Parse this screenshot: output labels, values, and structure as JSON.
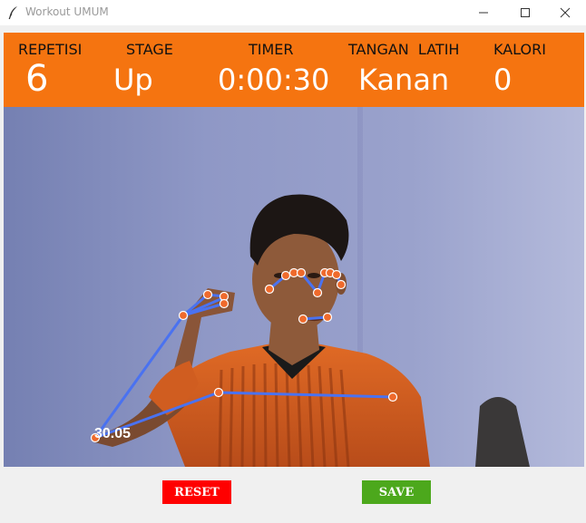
{
  "window": {
    "title": "Workout UMUM"
  },
  "stats": {
    "repetisi_label": "REPETISI",
    "repetisi_value": "6",
    "stage_label": "STAGE",
    "stage_value": "Up",
    "timer_label": "TIMER",
    "timer_value": "0:00:30",
    "tangan_label": "TANGAN  LATIH",
    "tangan_value": "Kanan",
    "kalori_label": "KALORI",
    "kalori_value": "0"
  },
  "camera": {
    "overlay_text": "30.05"
  },
  "buttons": {
    "reset_label": "RESET",
    "save_label": "SAVE"
  },
  "colors": {
    "header_orange": "#f57410",
    "reset_red": "#ff0000",
    "save_green": "#4ca81c",
    "skeleton_line": "#4a72f0",
    "landmark_dot": "#ef6a2c"
  },
  "icons": {
    "app_icon": "feather-icon",
    "minimize": "minimize-icon",
    "maximize": "maximize-icon",
    "close": "close-icon"
  }
}
